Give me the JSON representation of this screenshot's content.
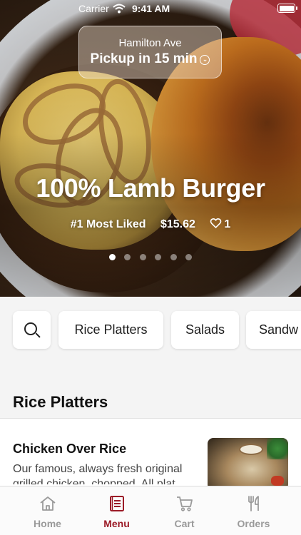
{
  "status_bar": {
    "carrier": "Carrier",
    "time": "9:41 AM"
  },
  "pickup": {
    "location": "Hamilton Ave",
    "eta": "Pickup in 15 min"
  },
  "hero": {
    "title": "100% Lamb Burger",
    "badge": "#1 Most Liked",
    "price": "$15.62",
    "likes": "1",
    "carousel": {
      "count": 6,
      "active_index": 0
    }
  },
  "categories": [
    "Rice Platters",
    "Salads",
    "Sandw"
  ],
  "section": {
    "title": "Rice Platters"
  },
  "menu_item": {
    "name": "Chicken Over Rice",
    "description": "Our famous, always fresh original grilled chicken, chopped. All plat..."
  },
  "tabs": [
    {
      "label": "Home",
      "icon": "home-icon",
      "active": false
    },
    {
      "label": "Menu",
      "icon": "menu-icon",
      "active": true
    },
    {
      "label": "Cart",
      "icon": "cart-icon",
      "active": false
    },
    {
      "label": "Orders",
      "icon": "utensils-icon",
      "active": false
    }
  ],
  "colors": {
    "accent": "#9b1b27",
    "inactive": "#9a9a9a"
  }
}
